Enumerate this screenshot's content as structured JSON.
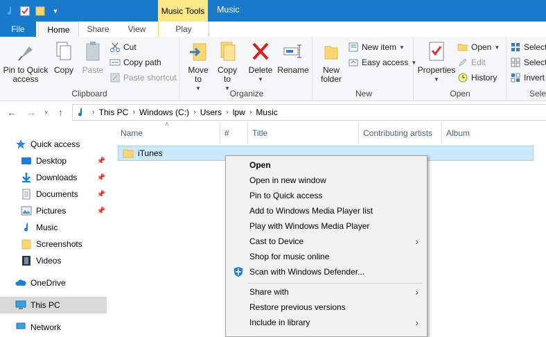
{
  "window": {
    "title": "Music",
    "context_tab_group": "Music Tools"
  },
  "ribbon_tabs": {
    "file": "File",
    "home": "Home",
    "share": "Share",
    "view": "View",
    "play": "Play"
  },
  "ribbon": {
    "clipboard": {
      "label": "Clipboard",
      "pin": "Pin to Quick access",
      "copy": "Copy",
      "paste": "Paste",
      "cut": "Cut",
      "copy_path": "Copy path",
      "paste_shortcut": "Paste shortcut"
    },
    "organize": {
      "label": "Organize",
      "move_to": "Move to",
      "copy_to": "Copy to",
      "delete": "Delete",
      "rename": "Rename"
    },
    "new": {
      "label": "New",
      "new_folder": "New folder",
      "new_item": "New item",
      "easy_access": "Easy access"
    },
    "open": {
      "label": "Open",
      "properties": "Properties",
      "open": "Open",
      "edit": "Edit",
      "history": "History"
    },
    "select": {
      "label": "Sele",
      "select_all": "Select",
      "select_none": "Select",
      "invert": "Invert"
    }
  },
  "address": {
    "crumbs": [
      "This PC",
      "Windows (C:)",
      "Users",
      "lpw",
      "Music"
    ]
  },
  "nav_pane": {
    "items": [
      {
        "label": "Quick access",
        "icon": "star-icon"
      },
      {
        "label": "Desktop",
        "icon": "desktop-icon"
      },
      {
        "label": "Downloads",
        "icon": "download-icon"
      },
      {
        "label": "Documents",
        "icon": "documents-icon"
      },
      {
        "label": "Pictures",
        "icon": "pictures-icon"
      },
      {
        "label": "Music",
        "icon": "music-icon"
      },
      {
        "label": "Screenshots",
        "icon": "folder-icon"
      },
      {
        "label": "Videos",
        "icon": "videos-icon"
      },
      {
        "label": "OneDrive",
        "icon": "cloud-icon"
      },
      {
        "label": "This PC",
        "icon": "computer-icon"
      },
      {
        "label": "Network",
        "icon": "network-icon"
      }
    ]
  },
  "columns": {
    "name": "Name",
    "number": "#",
    "title": "Title",
    "contributing_artists": "Contributing artists",
    "album": "Album"
  },
  "files": [
    {
      "name": "iTunes"
    }
  ],
  "context_menu": {
    "items": [
      {
        "label": "Open"
      },
      {
        "label": "Open in new window"
      },
      {
        "label": "Pin to Quick access"
      },
      {
        "label": "Add to Windows Media Player list"
      },
      {
        "label": "Play with Windows Media Player"
      },
      {
        "label": "Cast to Device"
      },
      {
        "label": "Shop for music online"
      },
      {
        "label": "Scan with Windows Defender..."
      },
      {
        "label": "Share with"
      },
      {
        "label": "Restore previous versions"
      },
      {
        "label": "Include in library"
      }
    ]
  },
  "colors": {
    "titlebar": "#1979ca",
    "context_tab": "#fce888",
    "selection": "#cce8ff"
  }
}
